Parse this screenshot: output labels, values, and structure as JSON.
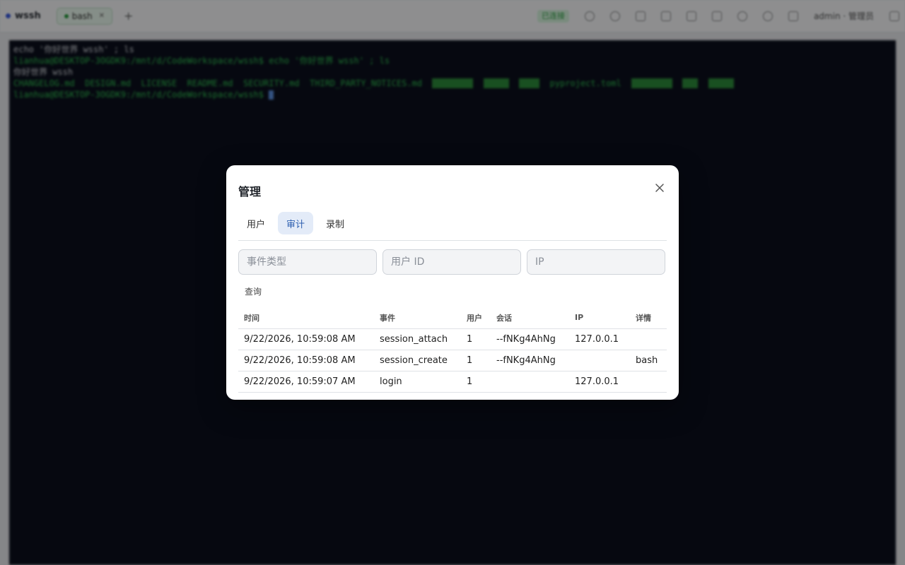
{
  "app": {
    "brand": "wssh",
    "tab_label": "bash",
    "status_badge": "已连接",
    "user_label": "admin · 管理员"
  },
  "terminal": {
    "lines": [
      "echo '你好世界 wssh' ; ls",
      "lianhua@DESKTOP-3OGDK9:/mnt/d/CodeWorkspace/wssh$ echo '你好世界 wssh' ; ls",
      "你好世界 wssh",
      "CHANGELOG.md  DESIGN.md  LICENSE  README.md  SECURITY.md  THIRD_PARTY_NOTICES.md",
      "lianhua@DESKTOP-3OGDK9:/mnt/d/CodeWorkspace/wssh$"
    ],
    "ls_extra": "pyproject.toml"
  },
  "modal": {
    "title": "管理",
    "tabs": [
      {
        "label": "用户",
        "active": false
      },
      {
        "label": "审计",
        "active": true
      },
      {
        "label": "录制",
        "active": false
      }
    ],
    "filters": {
      "event_type_placeholder": "事件类型",
      "user_id_placeholder": "用户 ID",
      "ip_placeholder": "IP"
    },
    "query_label": "查询",
    "table": {
      "headers": [
        "时间",
        "事件",
        "用户",
        "会话",
        "IP",
        "详情"
      ],
      "rows": [
        {
          "time": "9/22/2026, 10:59:08 AM",
          "event": "session_attach",
          "user": "1",
          "session": "--fNKg4AhNg",
          "ip": "127.0.0.1",
          "detail": ""
        },
        {
          "time": "9/22/2026, 10:59:08 AM",
          "event": "session_create",
          "user": "1",
          "session": "--fNKg4AhNg",
          "ip": "",
          "detail": "bash"
        },
        {
          "time": "9/22/2026, 10:59:07 AM",
          "event": "login",
          "user": "1",
          "session": "",
          "ip": "127.0.0.1",
          "detail": ""
        }
      ]
    }
  },
  "colors": {
    "accent": "#2d5fb0",
    "active_tab_bg": "#e3ebf8",
    "terminal_bg": "#0b0f1c"
  }
}
